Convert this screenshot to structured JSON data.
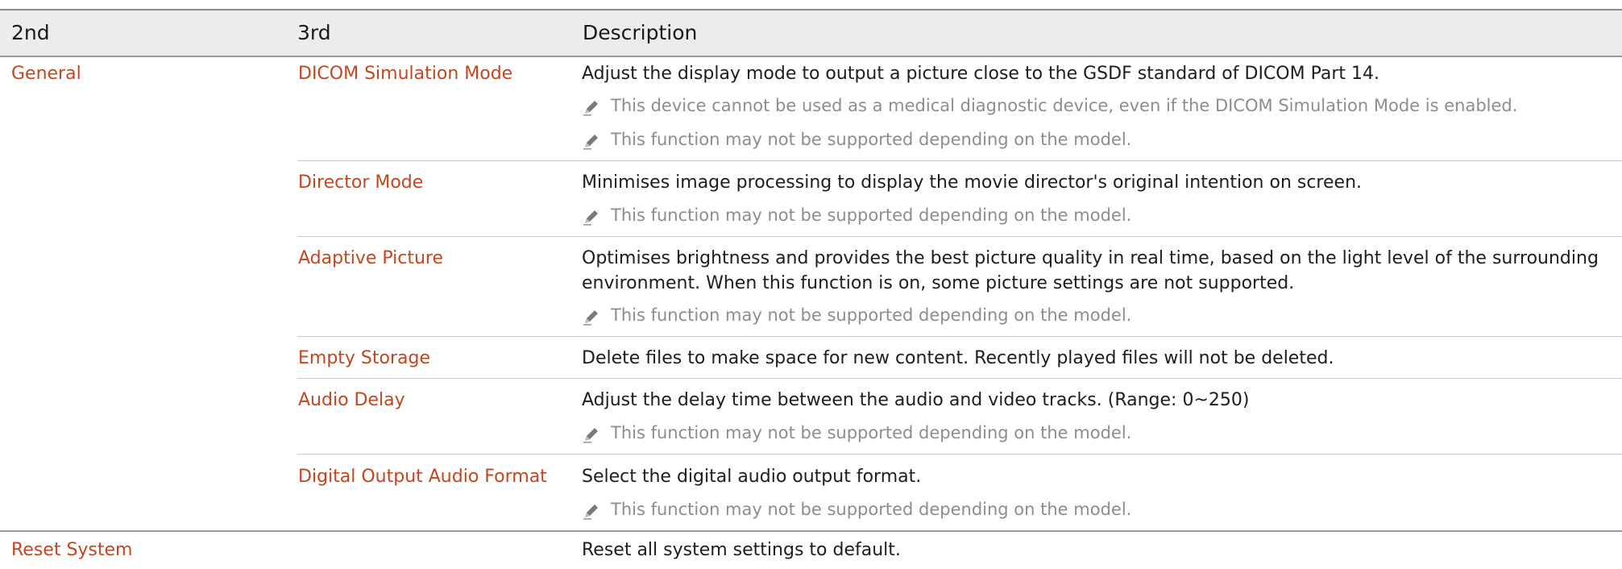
{
  "header": {
    "col1": "2nd",
    "col2": "3rd",
    "col3": "Description"
  },
  "colors": {
    "accent": "#c5451e",
    "note": "#8d8d8d"
  },
  "note_icon": "pencil-icon",
  "rows": [
    {
      "second": "General",
      "third": "DICOM Simulation Mode",
      "desc": "Adjust the display mode to output a picture close to the GSDF standard of DICOM Part 14.",
      "notes": [
        "This device cannot be used as a medical diagnostic device, even if the DICOM Simulation Mode is enabled.",
        "This function may not be supported depending on the model."
      ]
    },
    {
      "third": "Director Mode",
      "desc": "Minimises image processing to display the movie director's original intention on screen.",
      "notes": [
        "This function may not be supported depending on the model."
      ]
    },
    {
      "third": "Adaptive Picture",
      "desc1": "Optimises brightness and provides the best picture quality in real time, based on the light level of the surrounding",
      "desc2": "environment. When this function is on, some picture settings are not supported.",
      "notes": [
        "This function may not be supported depending on the model."
      ]
    },
    {
      "third": "Empty Storage",
      "desc": "Delete files to make space for new content. Recently played files will not be deleted."
    },
    {
      "third": "Audio Delay",
      "desc": "Adjust the delay time between the audio and video tracks. (Range: 0~250)",
      "notes": [
        "This function may not be supported depending on the model."
      ]
    },
    {
      "third": "Digital Output Audio Format",
      "desc": "Select the digital audio output format.",
      "notes": [
        "This function may not be supported depending on the model."
      ]
    },
    {
      "second": "Reset System",
      "desc": "Reset all system settings to default."
    }
  ]
}
